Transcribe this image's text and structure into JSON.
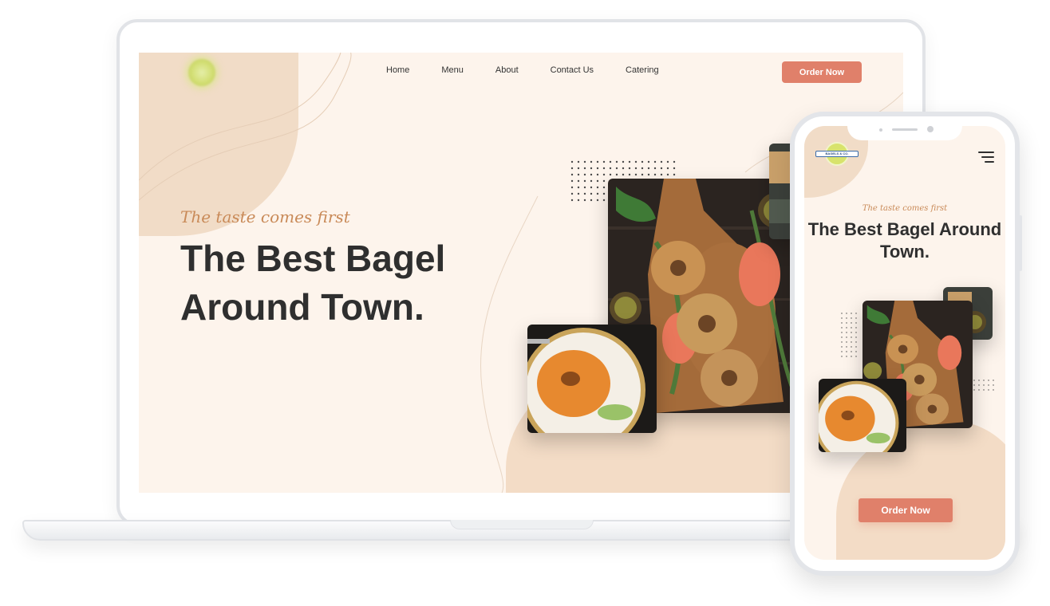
{
  "desktop": {
    "nav": {
      "items": [
        "Home",
        "Menu",
        "About",
        "Contact Us",
        "Catering"
      ]
    },
    "cta_label": "Order Now",
    "tagline": "The taste comes first",
    "headline": "The Best Bagel Around Town."
  },
  "mobile": {
    "logo_text": "BAGELS & CO.",
    "tagline": "The taste comes first",
    "headline": "The Best Bagel Around Town.",
    "cta_label": "Order Now"
  },
  "icons": {
    "menu": "hamburger-menu-icon",
    "logo": "bagel-logo-icon"
  },
  "colors": {
    "accent": "#e0806a",
    "background": "#fdf4ec",
    "blob": "#f1dcc7",
    "tagline": "#c98a58",
    "headline": "#2f2f2f"
  }
}
